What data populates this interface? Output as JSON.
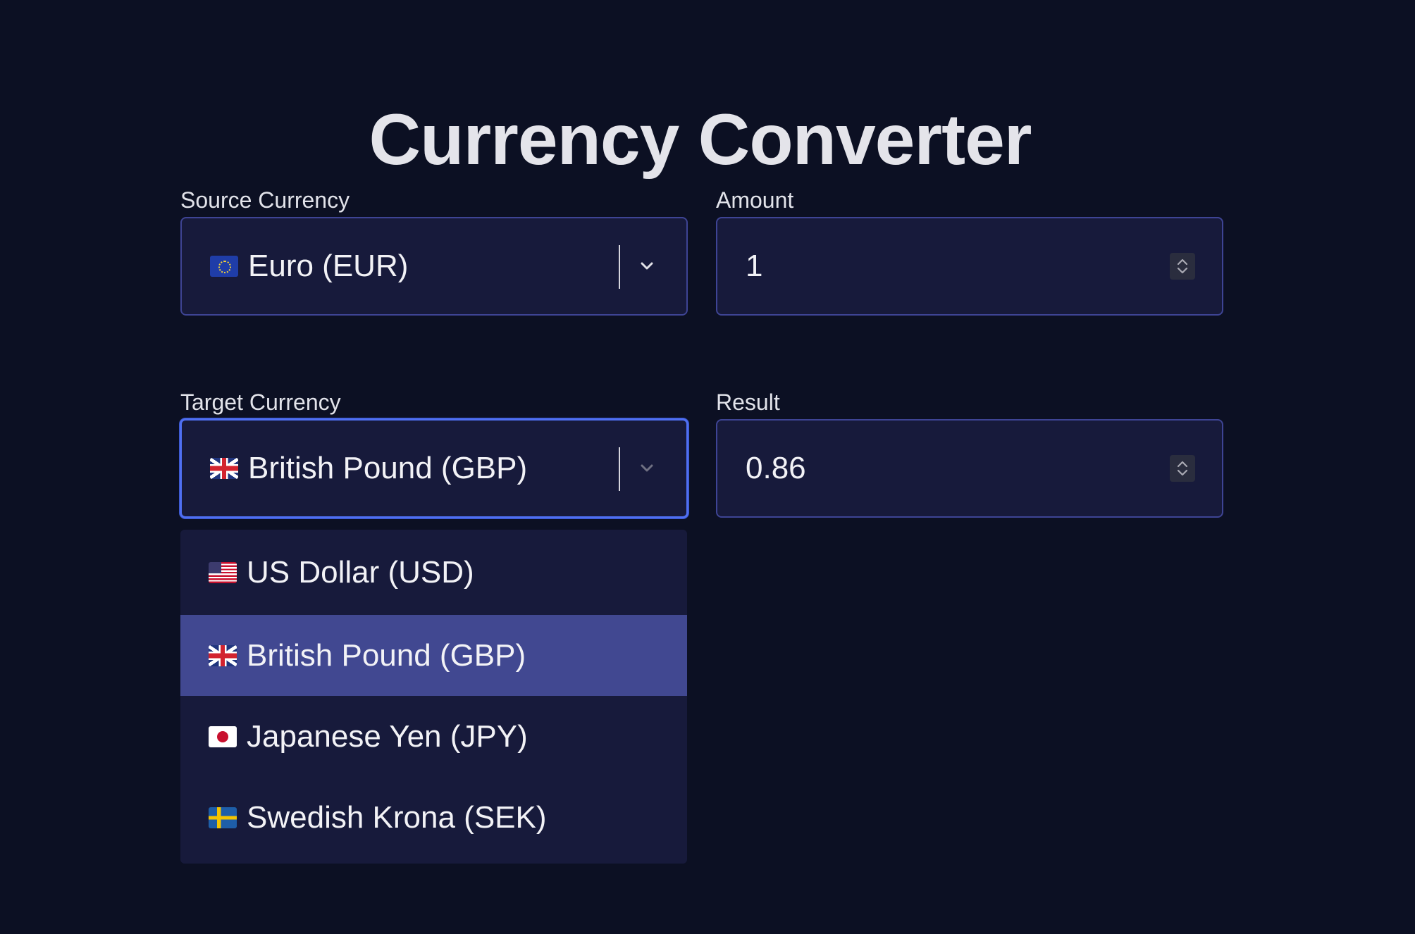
{
  "app": {
    "title": "Currency Converter"
  },
  "source": {
    "label": "Source Currency",
    "selected": "Euro (EUR)",
    "flag_icon": "eu-flag-icon"
  },
  "amount": {
    "label": "Amount",
    "value": "1"
  },
  "target": {
    "label": "Target Currency",
    "selected": "British Pound (GBP)",
    "flag_icon": "gb-flag-icon",
    "focused": true
  },
  "result": {
    "label": "Result",
    "value": "0.86"
  },
  "dropdown": {
    "open": true,
    "options": [
      {
        "label": "US Dollar (USD)",
        "flag_icon": "us-flag-icon",
        "selected": false
      },
      {
        "label": "British Pound (GBP)",
        "flag_icon": "gb-flag-icon",
        "selected": true
      },
      {
        "label": "Japanese Yen (JPY)",
        "flag_icon": "jp-flag-icon",
        "selected": false
      },
      {
        "label": "Swedish Krona (SEK)",
        "flag_icon": "se-flag-icon",
        "selected": false
      }
    ]
  },
  "colors": {
    "background": "#0c1023",
    "field_background": "#171a3b",
    "field_border": "#3e4494",
    "focus_border": "#4f6ff2",
    "selected_option": "#414891"
  }
}
